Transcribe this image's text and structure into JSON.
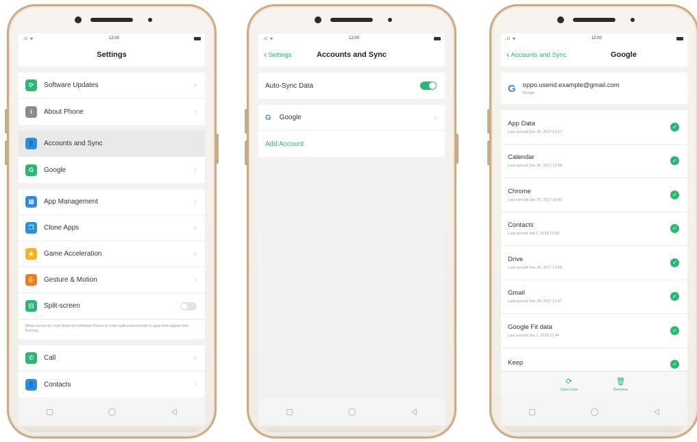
{
  "colors": {
    "accent": "#2bb673",
    "frame": "#c9ab86",
    "google_blue": "#4285f4"
  },
  "status_bar": {
    "time": "12:00",
    "signal": ".ıl ᯤ"
  },
  "phone1": {
    "title": "Settings",
    "groups": [
      [
        {
          "label": "Software Updates",
          "icon": "refresh-icon",
          "color": "#2bb673",
          "glyph": "⟳"
        },
        {
          "label": "About Phone",
          "icon": "info-icon",
          "color": "#8c8c8c",
          "glyph": "i"
        }
      ],
      [
        {
          "label": "Accounts and Sync",
          "icon": "person-icon",
          "color": "#2d8ee0",
          "glyph": "👤"
        },
        {
          "label": "Google",
          "icon": "google-icon",
          "color": "#2bb673",
          "glyph": "G"
        }
      ],
      [
        {
          "label": "App Management",
          "icon": "apps-grid-icon",
          "color": "#2d8ee0",
          "glyph": "▦"
        },
        {
          "label": "Clone Apps",
          "icon": "clone-icon",
          "color": "#2d8ee0",
          "glyph": "❐"
        },
        {
          "label": "Game Acceleration",
          "icon": "game-icon",
          "color": "#f5b324",
          "glyph": "◈"
        },
        {
          "label": "Gesture & Motion",
          "icon": "gesture-icon",
          "color": "#f07a2a",
          "glyph": "✋"
        },
        {
          "label": "Split-screen",
          "icon": "split-screen-icon",
          "color": "#2bb673",
          "glyph": "⊟"
        }
      ],
      [
        {
          "label": "Call",
          "icon": "phone-icon",
          "color": "#2bb673",
          "glyph": "✆"
        },
        {
          "label": "Contacts",
          "icon": "contacts-icon",
          "color": "#2d8ee0",
          "glyph": "👤"
        }
      ]
    ],
    "split_note": "When turned on, hold down the Multitask Button to enter split-screen mode in apps that support this function."
  },
  "phone2": {
    "back_label": "Settings",
    "title": "Accounts and Sync",
    "auto_sync_label": "Auto-Sync Data",
    "google_label": "Google",
    "add_account_label": "Add Account"
  },
  "phone3": {
    "back_label": "Accounts and Sync",
    "title": "Google",
    "email": "oppo.userid.example@gmail.com",
    "account_type": "Google",
    "sync_items": [
      {
        "name": "App Data",
        "synced": "Last synced Dec 26, 2017 12:57"
      },
      {
        "name": "Calendar",
        "synced": "Last synced Dec 26, 2017 12:58"
      },
      {
        "name": "Chrome",
        "synced": "Last synced Dec 26, 2017 16:43"
      },
      {
        "name": "Contacts",
        "synced": "Last synced Jan 1, 2018 13:58"
      },
      {
        "name": "Drive",
        "synced": "Last synced Dec 26, 2017 12:58"
      },
      {
        "name": "Gmail",
        "synced": "Last synced Dec 28, 2017 11:47"
      },
      {
        "name": "Google Fit data",
        "synced": "Last synced Jan 1, 2018 12:44"
      },
      {
        "name": "Keep",
        "synced": ""
      }
    ],
    "sync_now_label": "Sync now",
    "remove_label": "Remove"
  }
}
